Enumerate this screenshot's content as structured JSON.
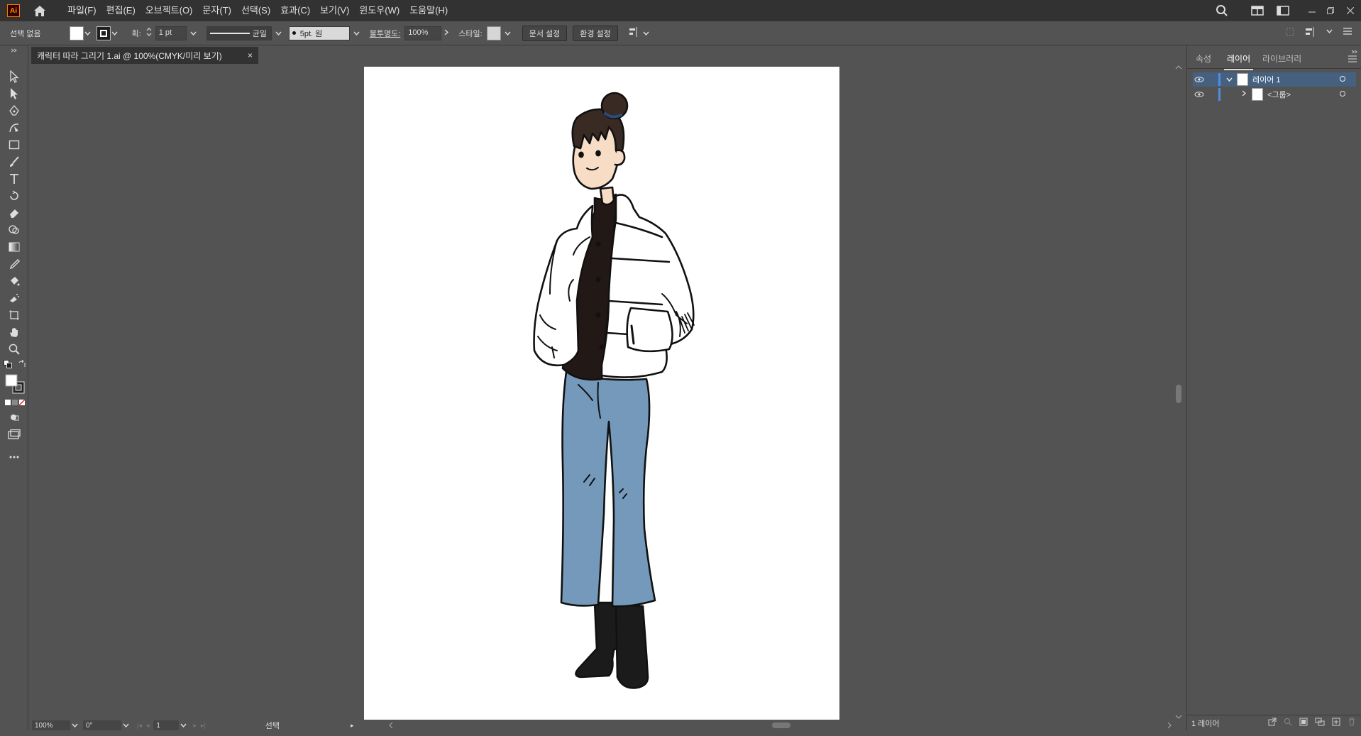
{
  "app": {
    "logo_text": "Ai",
    "menus": [
      "파일(F)",
      "편집(E)",
      "오브젝트(O)",
      "문자(T)",
      "선택(S)",
      "효과(C)",
      "보기(V)",
      "윈도우(W)",
      "도움말(H)"
    ]
  },
  "control_bar": {
    "selection_status": "선택 없음",
    "stroke_label": "획:",
    "stroke_weight": "1 pt",
    "stroke_profile": "균일",
    "brush": "5pt. 원",
    "opacity_label": "불투명도:",
    "opacity_value": "100%",
    "style_label": "스타일:",
    "doc_setup_button": "문서 설정",
    "preferences_button": "환경 설정"
  },
  "document_tab": {
    "title": "캐릭터 따라 그리기 1.ai @ 100%(CMYK/미리 보기)",
    "close": "×"
  },
  "status_bar": {
    "zoom": "100%",
    "rotation": "0°",
    "artboard_number": "1",
    "tool_name": "선택"
  },
  "layers_panel": {
    "tabs": [
      "속성",
      "레이어",
      "라이브러리"
    ],
    "active_tab": "레이어",
    "layers": [
      {
        "name": "레이어 1",
        "expanded": true,
        "selected": true
      },
      {
        "name": "<그룹>",
        "expanded": false,
        "selected": false
      }
    ],
    "footer_count": "1 레이어"
  },
  "colors": {
    "menubar_bg": "#323232",
    "panel_bg": "#535353",
    "layer_accent": "#4a90e2",
    "jeans": "#7499bb",
    "skin": "#f7dcc6"
  }
}
